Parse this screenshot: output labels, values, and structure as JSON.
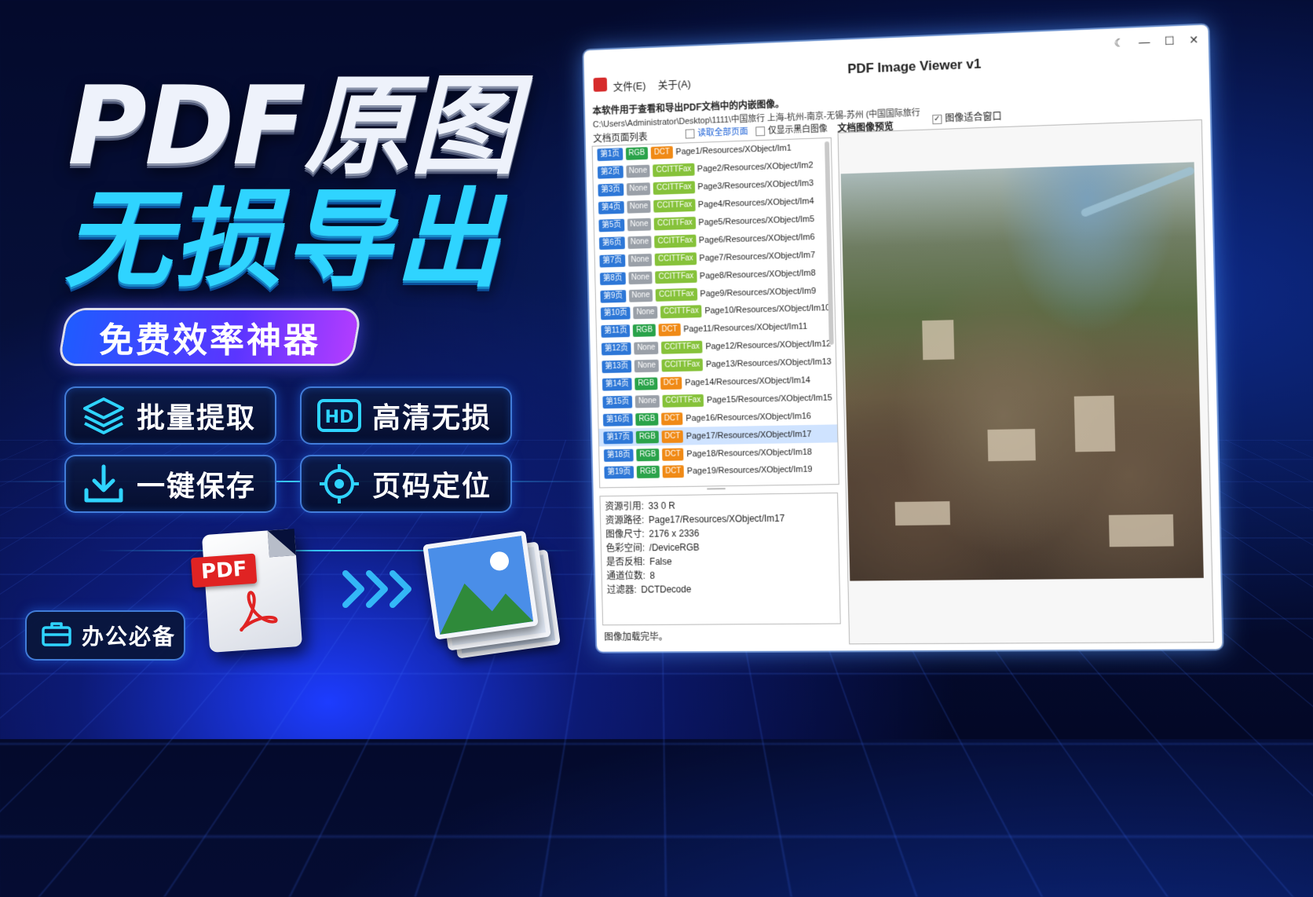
{
  "hero": {
    "title_line1": "PDF原图",
    "title_line2": "无损导出",
    "pill": "免费效率神器"
  },
  "features": [
    {
      "label": "批量提取",
      "icon": "layers-icon"
    },
    {
      "label": "高清无损",
      "icon": "hd-icon"
    },
    {
      "label": "一键保存",
      "icon": "download-icon"
    },
    {
      "label": "页码定位",
      "icon": "crosshair-icon"
    }
  ],
  "badge": {
    "label": "办公必备",
    "icon": "briefcase-icon"
  },
  "pdf_icon": {
    "tag": "PDF"
  },
  "colors": {
    "accent_cyan": "#2fd4ff",
    "page_tag": "#2d77d7",
    "rgb_tag": "#2aa34a",
    "dct_tag": "#f08a16",
    "ccitt_tag": "#86c23a",
    "none_tag": "#9aa0a8"
  },
  "app": {
    "title": "PDF Image Viewer v1",
    "menu": [
      "文件(E)",
      "关于(A)"
    ],
    "description": "本软件用于查看和导出PDF文档中的内嵌图像。",
    "path": "C:\\Users\\Administrator\\Desktop\\1111\\中国旅行 上海-杭州-南京-无锡-苏州 (中国国际旅行",
    "list_label": "文档页面列表",
    "read_all": "读取全部页面",
    "bw_only": "仅显示黑白图像",
    "preview_label": "文档图像预览",
    "fit_window": "图像适合窗口",
    "fit_window_checked": true,
    "rows": [
      {
        "page": "第1页",
        "color": "RGB",
        "filter": "DCT",
        "path": "Page1/Resources/XObject/Im1"
      },
      {
        "page": "第2页",
        "color": "None",
        "filter": "CCITTFax",
        "path": "Page2/Resources/XObject/Im2"
      },
      {
        "page": "第3页",
        "color": "None",
        "filter": "CCITTFax",
        "path": "Page3/Resources/XObject/Im3"
      },
      {
        "page": "第4页",
        "color": "None",
        "filter": "CCITTFax",
        "path": "Page4/Resources/XObject/Im4"
      },
      {
        "page": "第5页",
        "color": "None",
        "filter": "CCITTFax",
        "path": "Page5/Resources/XObject/Im5"
      },
      {
        "page": "第6页",
        "color": "None",
        "filter": "CCITTFax",
        "path": "Page6/Resources/XObject/Im6"
      },
      {
        "page": "第7页",
        "color": "None",
        "filter": "CCITTFax",
        "path": "Page7/Resources/XObject/Im7"
      },
      {
        "page": "第8页",
        "color": "None",
        "filter": "CCITTFax",
        "path": "Page8/Resources/XObject/Im8"
      },
      {
        "page": "第9页",
        "color": "None",
        "filter": "CCITTFax",
        "path": "Page9/Resources/XObject/Im9"
      },
      {
        "page": "第10页",
        "color": "None",
        "filter": "CCITTFax",
        "path": "Page10/Resources/XObject/Im10"
      },
      {
        "page": "第11页",
        "color": "RGB",
        "filter": "DCT",
        "path": "Page11/Resources/XObject/Im11"
      },
      {
        "page": "第12页",
        "color": "None",
        "filter": "CCITTFax",
        "path": "Page12/Resources/XObject/Im12"
      },
      {
        "page": "第13页",
        "color": "None",
        "filter": "CCITTFax",
        "path": "Page13/Resources/XObject/Im13"
      },
      {
        "page": "第14页",
        "color": "RGB",
        "filter": "DCT",
        "path": "Page14/Resources/XObject/Im14"
      },
      {
        "page": "第15页",
        "color": "None",
        "filter": "CCITTFax",
        "path": "Page15/Resources/XObject/Im15"
      },
      {
        "page": "第16页",
        "color": "RGB",
        "filter": "DCT",
        "path": "Page16/Resources/XObject/Im16"
      },
      {
        "page": "第17页",
        "color": "RGB",
        "filter": "DCT",
        "path": "Page17/Resources/XObject/Im17",
        "selected": true
      },
      {
        "page": "第18页",
        "color": "RGB",
        "filter": "DCT",
        "path": "Page18/Resources/XObject/Im18"
      },
      {
        "page": "第19页",
        "color": "RGB",
        "filter": "DCT",
        "path": "Page19/Resources/XObject/Im19"
      }
    ],
    "info": [
      {
        "key": "资源引用:",
        "value": "33 0 R"
      },
      {
        "key": "资源路径:",
        "value": "Page17/Resources/XObject/Im17"
      },
      {
        "key": "图像尺寸:",
        "value": "2176 x 2336"
      },
      {
        "key": "色彩空间:",
        "value": "/DeviceRGB"
      },
      {
        "key": "是否反相:",
        "value": "False"
      },
      {
        "key": "通道位数:",
        "value": "8"
      },
      {
        "key": "过滤器:",
        "value": "DCTDecode"
      }
    ],
    "status": "图像加载完毕。"
  }
}
